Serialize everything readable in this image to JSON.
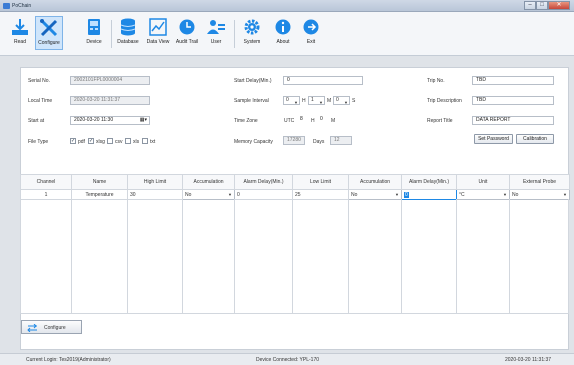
{
  "window": {
    "title": "PoChain"
  },
  "toolbar": {
    "read": "Read",
    "configure": "Configure",
    "device": "Device",
    "database": "Database",
    "data_view": "Data View",
    "audit_trail": "Audit Trail",
    "user": "User",
    "system": "System",
    "about": "About",
    "exit": "Exit"
  },
  "form": {
    "serial_no_label": "Serial No.",
    "serial_no": "2002101FPL0000004",
    "local_time_label": "Local Time",
    "local_time": "2020-03-20 11:31:37",
    "start_at_label": "Start at",
    "start_at": "2020-03-20 11:30",
    "file_type_label": "File Type",
    "file_types": [
      {
        "label": "pdf",
        "checked": true
      },
      {
        "label": "xlsg",
        "checked": true
      },
      {
        "label": "csv",
        "checked": false
      },
      {
        "label": "xls",
        "checked": false
      },
      {
        "label": "txt",
        "checked": false
      }
    ],
    "start_delay_label": "Start Delay(Min.)",
    "start_delay": "0",
    "sample_interval_label": "Sample Interval",
    "si_h": "0",
    "si_h_unit": "H",
    "si_m": "1",
    "si_m_unit": "M",
    "si_s": "0",
    "si_s_unit": "S",
    "time_zone_label": "Time Zone",
    "tz_prefix": "UTC",
    "tz_h": "8",
    "tz_h_unit": "H",
    "tz_m": "0",
    "tz_m_unit": "M",
    "memory_capacity_label": "Memory Capacity",
    "memory_capacity": "17280",
    "days_label": "Days",
    "days": "12",
    "trip_no_label": "Trip No.",
    "trip_no": "TBD",
    "trip_desc_label": "Trip Description",
    "trip_desc": "TBD",
    "report_title_label": "Report Title",
    "report_title": "DATA REPORT",
    "set_password": "Set Password",
    "calibration": "Calibration"
  },
  "table": {
    "headers": [
      "Channel",
      "Name",
      "High Limit",
      "Accumulation",
      "Alarm Delay(Min.)",
      "Low Limit",
      "Accumulation",
      "Alarm Delay(Min.)",
      "Unit",
      "External Probe"
    ],
    "row": {
      "channel": "1",
      "name": "Temperature",
      "high_limit": "30",
      "accumulation1": "No",
      "alarm_delay1": "0",
      "low_limit": "25",
      "accumulation2": "No",
      "alarm_delay2": "0",
      "unit": "°C",
      "external_probe": "No"
    }
  },
  "bottom": {
    "configure_button": "Configure"
  },
  "status": {
    "login": "Current Login: Tes2019(Administrator)",
    "device": "Device Connected: YPL-170",
    "datetime": "2020-03-20 11:31:37"
  },
  "colors": {
    "accent": "#1e88e5",
    "active_tab": "#cfe5fb"
  }
}
